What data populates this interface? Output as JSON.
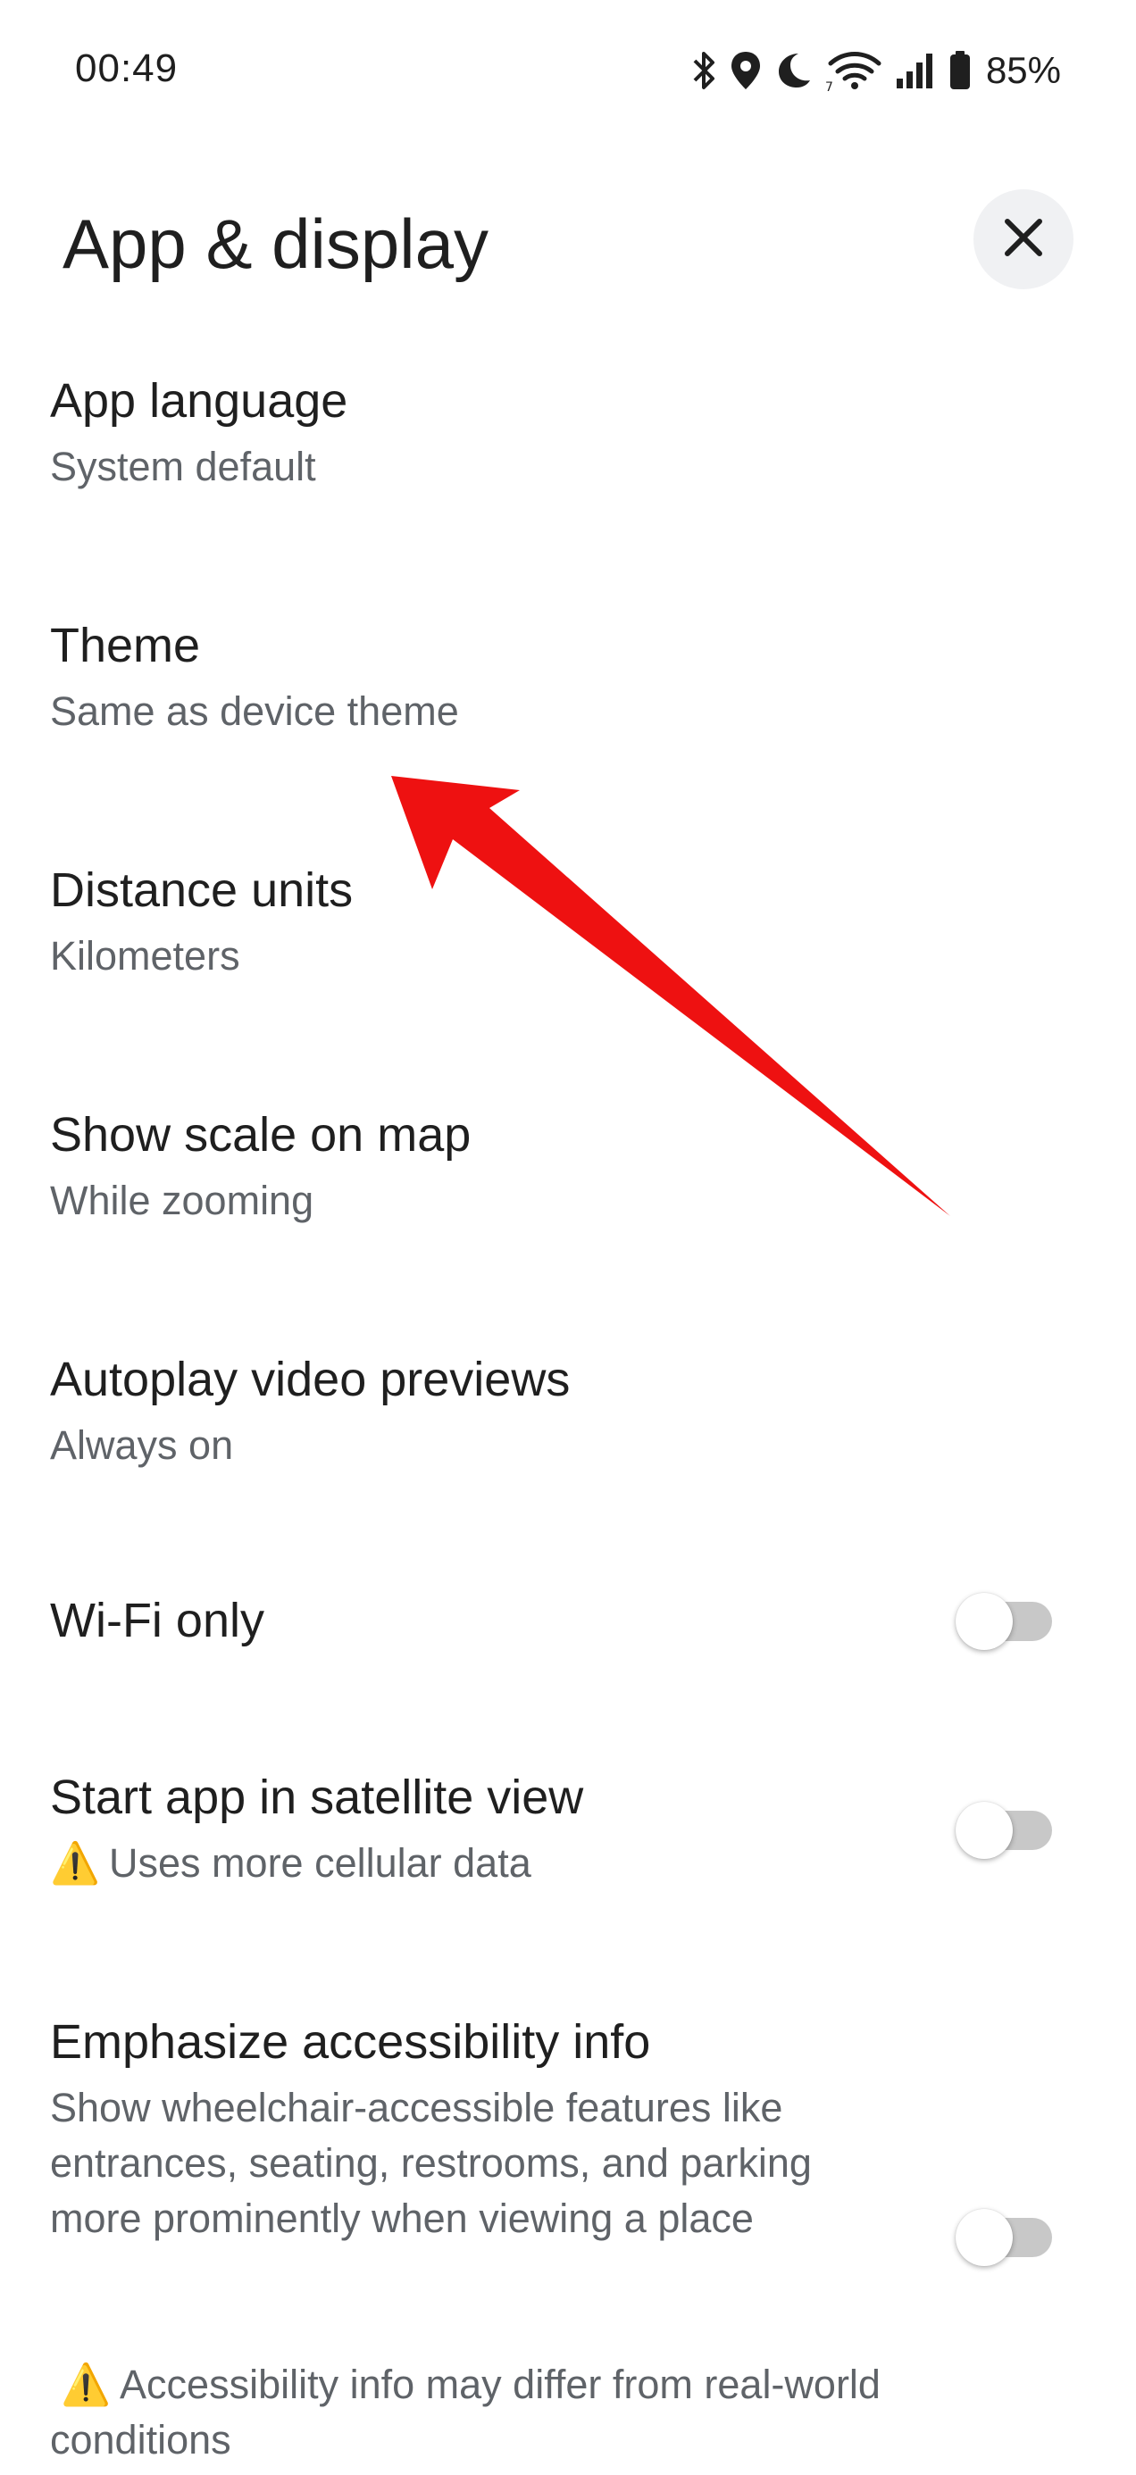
{
  "status_bar": {
    "time": "00:49",
    "battery": "85%",
    "icons": [
      "bluetooth-icon",
      "location-icon",
      "do-not-disturb-moon-icon",
      "wifi-icon",
      "cellular-signal-icon",
      "battery-icon"
    ]
  },
  "header": {
    "title": "App & display",
    "close_icon": "close-icon"
  },
  "settings": [
    {
      "title": "App language",
      "subtitle": "System default"
    },
    {
      "title": "Theme",
      "subtitle": "Same as device theme"
    },
    {
      "title": "Distance units",
      "subtitle": "Kilometers"
    },
    {
      "title": "Show scale on map",
      "subtitle": "While zooming"
    },
    {
      "title": "Autoplay video previews",
      "subtitle": "Always on"
    }
  ],
  "toggles": [
    {
      "title": "Wi-Fi only",
      "on": false
    },
    {
      "title": "Start app in satellite view",
      "subtitle": "Uses more cellular data",
      "on": false
    },
    {
      "title": "Emphasize accessibility info",
      "description": "Show wheelchair-accessible features like entrances, seating, restrooms, and parking more prominently when viewing a place",
      "on": false
    }
  ],
  "footer_note": "Accessibility info may differ from real-world conditions",
  "warning_icon": "⚠️",
  "colors": {
    "annotation_arrow": "#ee1111",
    "toggle_off_track": "#c8c8c8",
    "secondary_text": "#5f6368"
  }
}
